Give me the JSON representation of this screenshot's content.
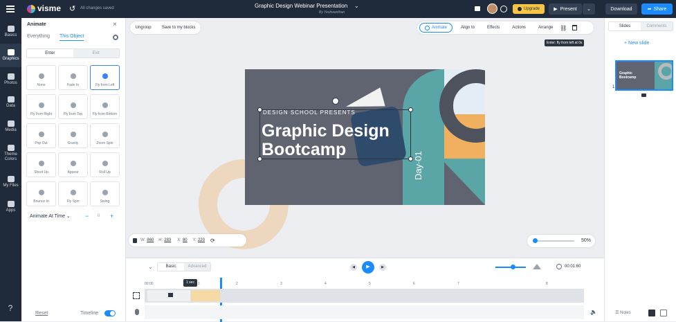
{
  "app": {
    "logo": "visme",
    "save_status": "All changes saved"
  },
  "document": {
    "title": "Graphic Design Webinar Presentation",
    "author": "By Yeshwanthan"
  },
  "topbar": {
    "upgrade": "Upgrade",
    "present": "Present",
    "download": "Download",
    "share": "Share"
  },
  "rail": [
    {
      "label": "Basics",
      "icon": "basics-icon"
    },
    {
      "label": "Graphics",
      "icon": "graphics-icon"
    },
    {
      "label": "Photos",
      "icon": "photos-icon"
    },
    {
      "label": "Data",
      "icon": "data-icon"
    },
    {
      "label": "Media",
      "icon": "media-icon"
    },
    {
      "label": "Theme Colors",
      "icon": "theme-colors-icon"
    },
    {
      "label": "My Files",
      "icon": "my-files-icon"
    },
    {
      "label": "Apps",
      "icon": "apps-icon"
    }
  ],
  "panel": {
    "title": "Animate",
    "tabs": [
      "Everything",
      "This Object"
    ],
    "mode_tabs": [
      "Enter",
      "Exit"
    ],
    "tiles": [
      "None",
      "Fade In",
      "Fly from Left",
      "Fly from Right",
      "Fly from Top",
      "Fly from Bottom",
      "Pop Out",
      "Gravity",
      "Zoom Spin",
      "Shoot Up",
      "Appear",
      "Roll Up",
      "Bounce In",
      "Fly Spin",
      "Swing"
    ],
    "animate_at_time": "Animate At Time",
    "time_value": "0",
    "reset": "Reset",
    "timeline_label": "Timeline"
  },
  "toolbar": {
    "ungroup": "Ungroup",
    "save_block": "Save to my blocks",
    "animate": "Animate",
    "align": "Align to",
    "effects": "Effects",
    "actions": "Actions",
    "arrange": "Arrange",
    "tooltip": "Enter: fly from left at 0s"
  },
  "slide": {
    "subtitle": "DESIGN SCHOOL PRESENTS",
    "title_line1": "Graphic Design",
    "title_line2": "Bootcamp",
    "day": "Day-01"
  },
  "dims": {
    "w_label": "W:",
    "w": "860",
    "h_label": "H:",
    "h": "283",
    "x_label": "X:",
    "x": "80",
    "y_label": "Y:",
    "y": "220"
  },
  "zoom": {
    "value": "50%",
    "level": 0.5
  },
  "right": {
    "tabs": [
      "Slides",
      "Comments"
    ],
    "new_slide": "+ New slide",
    "slide_num": "1",
    "notes": "Notes"
  },
  "timeline": {
    "tabs": [
      "Basic",
      "Advanced"
    ],
    "time": "00:01:60",
    "marker": "1 sec",
    "ticks": [
      "00:00",
      "1",
      "2",
      "3",
      "4",
      "5",
      "6",
      "7",
      "8"
    ]
  },
  "colors": {
    "accent": "#1a8cff",
    "upgrade": "#f6c544",
    "dark": "#1f2b3a",
    "teal": "#5aa6a6",
    "orange": "#f0b060"
  }
}
